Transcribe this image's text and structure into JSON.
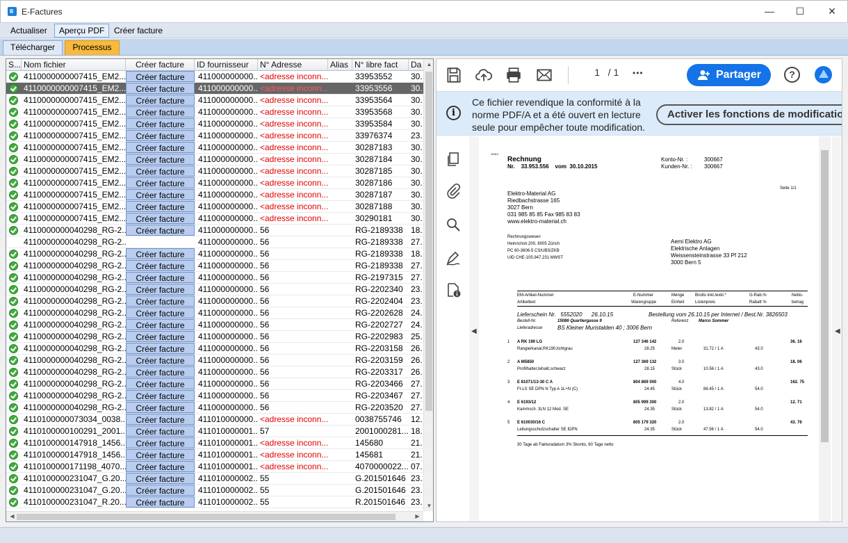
{
  "window": {
    "title": "E-Factures",
    "minimize": "—",
    "maximize": "☐",
    "close": "✕"
  },
  "menu": {
    "refresh": "Actualiser",
    "pdf_preview": "Aperçu PDF",
    "create_invoice": "Créer facture"
  },
  "tabs": {
    "upload": "Télécharger",
    "process": "Processus"
  },
  "grid": {
    "columns": [
      "S...",
      "Nom fichier",
      "Créer facture",
      "ID fournisseur",
      "N° Adresse",
      "Alias",
      "N° libre fact",
      "Da"
    ],
    "button_label": "Créer facture",
    "rows": [
      {
        "status": true,
        "file": "4110000000007415_EM2...",
        "btn": true,
        "supplier": "411000000000...",
        "addr": "<adresse inconn...",
        "unknown": true,
        "alias": "",
        "invoice_no": "33953552",
        "date": "30."
      },
      {
        "status": true,
        "file": "4110000000007415_EM2...",
        "btn": true,
        "supplier": "411000000000...",
        "addr": "<adresse inconn...",
        "unknown": true,
        "alias": "",
        "invoice_no": "33953556",
        "date": "30.",
        "selected": true
      },
      {
        "status": true,
        "file": "4110000000007415_EM2...",
        "btn": true,
        "supplier": "411000000000...",
        "addr": "<adresse inconn...",
        "unknown": true,
        "alias": "",
        "invoice_no": "33953564",
        "date": "30."
      },
      {
        "status": true,
        "file": "4110000000007415_EM2...",
        "btn": true,
        "supplier": "411000000000...",
        "addr": "<adresse inconn...",
        "unknown": true,
        "alias": "",
        "invoice_no": "33953568",
        "date": "30."
      },
      {
        "status": true,
        "file": "4110000000007415_EM2...",
        "btn": true,
        "supplier": "411000000000...",
        "addr": "<adresse inconn...",
        "unknown": true,
        "alias": "",
        "invoice_no": "33953584",
        "date": "30."
      },
      {
        "status": true,
        "file": "4110000000007415_EM2...",
        "btn": true,
        "supplier": "411000000000...",
        "addr": "<adresse inconn...",
        "unknown": true,
        "alias": "",
        "invoice_no": "33976374",
        "date": "23."
      },
      {
        "status": true,
        "file": "4110000000007415_EM2...",
        "btn": true,
        "supplier": "411000000000...",
        "addr": "<adresse inconn...",
        "unknown": true,
        "alias": "",
        "invoice_no": "30287183",
        "date": "30."
      },
      {
        "status": true,
        "file": "4110000000007415_EM2...",
        "btn": true,
        "supplier": "411000000000...",
        "addr": "<adresse inconn...",
        "unknown": true,
        "alias": "",
        "invoice_no": "30287184",
        "date": "30."
      },
      {
        "status": true,
        "file": "4110000000007415_EM2...",
        "btn": true,
        "supplier": "411000000000...",
        "addr": "<adresse inconn...",
        "unknown": true,
        "alias": "",
        "invoice_no": "30287185",
        "date": "30."
      },
      {
        "status": true,
        "file": "4110000000007415_EM2...",
        "btn": true,
        "supplier": "411000000000...",
        "addr": "<adresse inconn...",
        "unknown": true,
        "alias": "",
        "invoice_no": "30287186",
        "date": "30."
      },
      {
        "status": true,
        "file": "4110000000007415_EM2...",
        "btn": true,
        "supplier": "411000000000...",
        "addr": "<adresse inconn...",
        "unknown": true,
        "alias": "",
        "invoice_no": "30287187",
        "date": "30."
      },
      {
        "status": true,
        "file": "4110000000007415_EM2...",
        "btn": true,
        "supplier": "411000000000...",
        "addr": "<adresse inconn...",
        "unknown": true,
        "alias": "",
        "invoice_no": "30287188",
        "date": "30."
      },
      {
        "status": true,
        "file": "4110000000007415_EM2...",
        "btn": true,
        "supplier": "411000000000...",
        "addr": "<adresse inconn...",
        "unknown": true,
        "alias": "",
        "invoice_no": "30290181",
        "date": "30."
      },
      {
        "status": true,
        "file": "4110000000040298_RG-2...",
        "btn": true,
        "supplier": "411000000000...",
        "addr": "56",
        "unknown": false,
        "alias": "",
        "invoice_no": "RG-2189338",
        "date": "18."
      },
      {
        "status": false,
        "file": "4110000000040298_RG-2...",
        "btn": false,
        "supplier": "411000000000...",
        "addr": "56",
        "unknown": false,
        "alias": "",
        "invoice_no": "RG-2189338",
        "date": "27."
      },
      {
        "status": true,
        "file": "4110000000040298_RG-2...",
        "btn": true,
        "supplier": "411000000000...",
        "addr": "56",
        "unknown": false,
        "alias": "",
        "invoice_no": "RG-2189338",
        "date": "18."
      },
      {
        "status": true,
        "file": "4110000000040298_RG-2...",
        "btn": true,
        "supplier": "411000000000...",
        "addr": "56",
        "unknown": false,
        "alias": "",
        "invoice_no": "RG-2189338",
        "date": "27."
      },
      {
        "status": true,
        "file": "4110000000040298_RG-2...",
        "btn": true,
        "supplier": "411000000000...",
        "addr": "56",
        "unknown": false,
        "alias": "",
        "invoice_no": "RG-2197315",
        "date": "27."
      },
      {
        "status": true,
        "file": "4110000000040298_RG-2...",
        "btn": true,
        "supplier": "411000000000...",
        "addr": "56",
        "unknown": false,
        "alias": "",
        "invoice_no": "RG-2202340",
        "date": "23."
      },
      {
        "status": true,
        "file": "4110000000040298_RG-2...",
        "btn": true,
        "supplier": "411000000000...",
        "addr": "56",
        "unknown": false,
        "alias": "",
        "invoice_no": "RG-2202404",
        "date": "23."
      },
      {
        "status": true,
        "file": "4110000000040298_RG-2...",
        "btn": true,
        "supplier": "411000000000...",
        "addr": "56",
        "unknown": false,
        "alias": "",
        "invoice_no": "RG-2202628",
        "date": "24."
      },
      {
        "status": true,
        "file": "4110000000040298_RG-2...",
        "btn": true,
        "supplier": "411000000000...",
        "addr": "56",
        "unknown": false,
        "alias": "",
        "invoice_no": "RG-2202727",
        "date": "24."
      },
      {
        "status": true,
        "file": "4110000000040298_RG-2...",
        "btn": true,
        "supplier": "411000000000...",
        "addr": "56",
        "unknown": false,
        "alias": "",
        "invoice_no": "RG-2202983",
        "date": "25."
      },
      {
        "status": true,
        "file": "4110000000040298_RG-2...",
        "btn": true,
        "supplier": "411000000000...",
        "addr": "56",
        "unknown": false,
        "alias": "",
        "invoice_no": "RG-2203158",
        "date": "26."
      },
      {
        "status": true,
        "file": "4110000000040298_RG-2...",
        "btn": true,
        "supplier": "411000000000...",
        "addr": "56",
        "unknown": false,
        "alias": "",
        "invoice_no": "RG-2203159",
        "date": "26."
      },
      {
        "status": true,
        "file": "4110000000040298_RG-2...",
        "btn": true,
        "supplier": "411000000000...",
        "addr": "56",
        "unknown": false,
        "alias": "",
        "invoice_no": "RG-2203317",
        "date": "26."
      },
      {
        "status": true,
        "file": "4110000000040298_RG-2...",
        "btn": true,
        "supplier": "411000000000...",
        "addr": "56",
        "unknown": false,
        "alias": "",
        "invoice_no": "RG-2203466",
        "date": "27."
      },
      {
        "status": true,
        "file": "4110000000040298_RG-2...",
        "btn": true,
        "supplier": "411000000000...",
        "addr": "56",
        "unknown": false,
        "alias": "",
        "invoice_no": "RG-2203467",
        "date": "27."
      },
      {
        "status": true,
        "file": "4110000000040298_RG-2...",
        "btn": true,
        "supplier": "411000000000...",
        "addr": "56",
        "unknown": false,
        "alias": "",
        "invoice_no": "RG-2203520",
        "date": "27."
      },
      {
        "status": true,
        "file": "4110100000073034_0038...",
        "btn": true,
        "supplier": "411010000000...",
        "addr": "<adresse inconn...",
        "unknown": true,
        "alias": "",
        "invoice_no": "0038755746",
        "date": "12."
      },
      {
        "status": true,
        "file": "4110100000100291_2001...",
        "btn": true,
        "supplier": "411010000001...",
        "addr": "57",
        "unknown": false,
        "alias": "",
        "invoice_no": "2001000281...",
        "date": "18."
      },
      {
        "status": true,
        "file": "4110100000147918_1456...",
        "btn": true,
        "supplier": "411010000001...",
        "addr": "<adresse inconn...",
        "unknown": true,
        "alias": "",
        "invoice_no": "145680",
        "date": "21."
      },
      {
        "status": true,
        "file": "4110100000147918_1456...",
        "btn": true,
        "supplier": "411010000001...",
        "addr": "<adresse inconn...",
        "unknown": true,
        "alias": "",
        "invoice_no": "145681",
        "date": "21."
      },
      {
        "status": true,
        "file": "4110100000171198_4070...",
        "btn": true,
        "supplier": "411010000001...",
        "addr": "<adresse inconn...",
        "unknown": true,
        "alias": "",
        "invoice_no": "4070000022...",
        "date": "07."
      },
      {
        "status": true,
        "file": "4110100000231047_G.20...",
        "btn": true,
        "supplier": "411010000002...",
        "addr": "55",
        "unknown": false,
        "alias": "",
        "invoice_no": "G.201501646",
        "date": "23."
      },
      {
        "status": true,
        "file": "4110100000231047_G.20...",
        "btn": true,
        "supplier": "411010000002...",
        "addr": "55",
        "unknown": false,
        "alias": "",
        "invoice_no": "G.201501646",
        "date": "23."
      },
      {
        "status": true,
        "file": "4110100000231047_R.20...",
        "btn": true,
        "supplier": "411010000002...",
        "addr": "55",
        "unknown": false,
        "alias": "",
        "invoice_no": "R.201501646",
        "date": "23."
      }
    ]
  },
  "viewer": {
    "page_current": "1",
    "page_total": "/ 1",
    "more": "•••",
    "share_label": "Partager",
    "help": "?",
    "banner_text": "Ce fichier revendique la conformité à la norme PDF/A et a été ouvert en lecture seule pour empêcher toute modification.",
    "banner_button": "Activer les fonctions de modification"
  },
  "invoice": {
    "tiny_id": "15914",
    "title": "Rechnung",
    "nr_label": "Nr.",
    "nr_value": "33.953.556",
    "vom_label": "vom",
    "date": "30.10.2015",
    "konto_label": "Konto-Nr. :",
    "konto_value": "300667",
    "kunden_label": "Kunden-Nr. :",
    "kunden_value": "300667",
    "seite": "Seite   1/1",
    "sender": [
      "Elektro-Material AG",
      "Riedbachstrasse 165",
      "3027 Bern",
      "031 985 85 85     Fax 985 83 83",
      "www.elektro-material.ch"
    ],
    "billing": [
      "Rechnungswesen",
      "Heinrichstr.200, 8005 Zürich",
      "PC 80-3606-5 CS/UBS/ZKB",
      "UID CHE-105.947.231 MWST"
    ],
    "recipient": [
      "Aemi Elektro AG",
      "Elektrische Anlagen",
      "Weissensteinstrasse 33  Pf 212",
      "3000 Bern 5"
    ],
    "head1": [
      "EM-Artikel-Nummer",
      "E-Nummer",
      "Menge",
      "Brutto inkl./exkl.*",
      "G-Rab.%",
      "Netto-"
    ],
    "head2": [
      "Artikeltext",
      "Warengruppe",
      "Einheit",
      "Listenpreis",
      "Rabatt %",
      "betrag"
    ],
    "ls_label": "Lieferschein Nr.",
    "ls_value": "5552020",
    "ls_date": "26.10.15",
    "bestellung": "Bestellung vom  26.10.15 per Internet / Best.Nr. 3826503",
    "bestell_label": "Bestell-Nr.",
    "bestell_value": "15086 Quartiergasse 9",
    "referenz_label": "Referenz",
    "referenz_value": "Marco Sommer",
    "liefer_label": "Lieferadresse",
    "liefer_value": "BS Kleiner Muristalden 40 ; 3006 Bern",
    "items": [
      {
        "pos": "1",
        "code": "A RK 190 LG",
        "enr": "127 346 142",
        "qty": "2.0",
        "desc": "Rangierkanal,RK190,lichtgrau",
        "wg": "28.25",
        "unit": "Meter",
        "price": "31.72  /  1   A",
        "rab": "43.0",
        "net": "36. 16"
      },
      {
        "pos": "2",
        "code": "A M5850",
        "enr": "127 369 132",
        "qty": "3.0",
        "desc": "Profilhalter,tehalit,schwarz",
        "wg": "28.15",
        "unit": "Stück",
        "price": "10.56  /  1   A",
        "rab": "43.0",
        "net": "18. 06"
      },
      {
        "pos": "3",
        "code": "E 81071/13-30 C A",
        "enr": "804 869 000",
        "qty": "4.0",
        "desc": "FI-LS SE DPN N Typ A 1L+N (C)",
        "wg": "24.45",
        "unit": "Stück",
        "price": "88.45  /  1   A",
        "rab": "54.0",
        "net": "162. 75"
      },
      {
        "pos": "4",
        "code": "E 6193/12",
        "enr": "805 999 300",
        "qty": "2.0",
        "desc": "Kammsch. 3LN 12 Mod.   SE",
        "wg": "24.35",
        "unit": "Stück",
        "price": "13.82  /  1   A",
        "rab": "54.0",
        "net": "12. 71"
      },
      {
        "pos": "5",
        "code": "E 610030/16 C",
        "enr": "805 179 320",
        "qty": "2.0",
        "desc": "Leitungsschutzschalter SE IDPN",
        "wg": "24.35",
        "unit": "Stück",
        "price": "47.56  /  1   A",
        "rab": "54.0",
        "net": "43. 76"
      }
    ],
    "footer": "30 Tage ab Fakturadatum 3% Skonto, 60 Tage netto"
  }
}
